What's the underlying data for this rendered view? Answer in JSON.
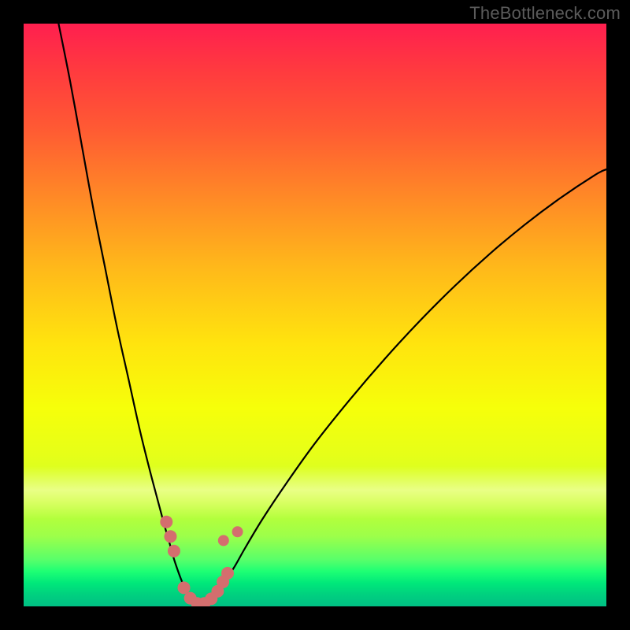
{
  "watermark": {
    "text": "TheBottleneck.com"
  },
  "colors": {
    "curve": "#000000",
    "markers_fill": "#d46e6e",
    "markers_stroke": "#d46e6e",
    "gradient_top": "#ff1f4f",
    "gradient_bottom": "#00c084",
    "background": "#000000"
  },
  "chart_data": {
    "type": "line",
    "title": "",
    "xlabel": "",
    "ylabel": "",
    "xlim": [
      0,
      100
    ],
    "ylim": [
      0,
      100
    ],
    "series": [
      {
        "name": "left-branch",
        "x": [
          6.0,
          8.0,
          10.0,
          12.0,
          14.0,
          16.0,
          18.0,
          20.0,
          22.0,
          24.0,
          25.0,
          26.0,
          27.5,
          29.0
        ],
        "y": [
          100.0,
          90.0,
          79.0,
          68.0,
          58.0,
          48.0,
          39.0,
          30.0,
          22.0,
          14.5,
          11.0,
          7.5,
          3.5,
          1.0
        ]
      },
      {
        "name": "right-branch",
        "x": [
          32.0,
          33.0,
          34.0,
          36.0,
          38.0,
          41.0,
          45.0,
          50.0,
          56.0,
          62.0,
          68.0,
          74.0,
          80.0,
          86.0,
          92.0,
          98.0,
          100.0
        ],
        "y": [
          1.0,
          2.0,
          3.7,
          6.5,
          10.0,
          15.0,
          21.0,
          28.0,
          35.5,
          42.5,
          49.0,
          55.0,
          60.5,
          65.5,
          70.0,
          74.0,
          75.0
        ]
      },
      {
        "name": "valley-floor",
        "x": [
          29.0,
          30.0,
          31.0,
          32.0
        ],
        "y": [
          1.0,
          0.3,
          0.3,
          1.0
        ]
      }
    ],
    "markers": [
      {
        "x": 24.5,
        "y": 14.5,
        "r": 8
      },
      {
        "x": 25.2,
        "y": 12.0,
        "r": 8
      },
      {
        "x": 25.8,
        "y": 9.5,
        "r": 8
      },
      {
        "x": 27.5,
        "y": 3.2,
        "r": 8
      },
      {
        "x": 28.6,
        "y": 1.4,
        "r": 8
      },
      {
        "x": 29.8,
        "y": 0.5,
        "r": 8
      },
      {
        "x": 31.0,
        "y": 0.5,
        "r": 8
      },
      {
        "x": 32.2,
        "y": 1.3,
        "r": 8
      },
      {
        "x": 33.3,
        "y": 2.6,
        "r": 8
      },
      {
        "x": 34.2,
        "y": 4.2,
        "r": 8
      },
      {
        "x": 35.0,
        "y": 5.7,
        "r": 8
      },
      {
        "x": 34.3,
        "y": 11.3,
        "r": 7
      },
      {
        "x": 36.7,
        "y": 12.8,
        "r": 7
      }
    ]
  }
}
